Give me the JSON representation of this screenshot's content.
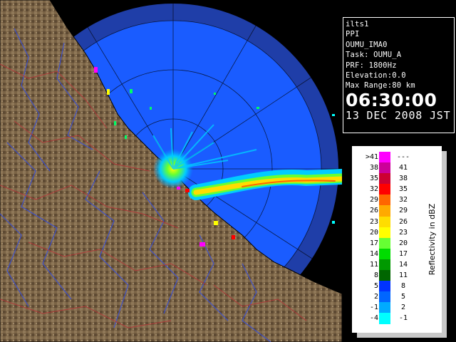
{
  "info_panel": {
    "lines": [
      "ilts1",
      "PPI",
      "OUMU_IMA0",
      "Task: OUMU_A",
      "PRF: 1800Hz",
      "Elevation:0.0",
      "Max Range:80 km"
    ],
    "time": "06:30:00",
    "date": "13 DEC 2008 JST"
  },
  "legend": {
    "title": "Reflectivity in dBZ",
    "rows": [
      {
        "lo": ">41",
        "hi": "---",
        "color": "#ff00ff"
      },
      {
        "lo": "38",
        "hi": "41",
        "color": "#cc0099"
      },
      {
        "lo": "35",
        "hi": "38",
        "color": "#cc0033"
      },
      {
        "lo": "32",
        "hi": "35",
        "color": "#ff0000"
      },
      {
        "lo": "29",
        "hi": "32",
        "color": "#ff6600"
      },
      {
        "lo": "26",
        "hi": "29",
        "color": "#ffaa00"
      },
      {
        "lo": "23",
        "hi": "26",
        "color": "#ffdd00"
      },
      {
        "lo": "20",
        "hi": "23",
        "color": "#ffff00"
      },
      {
        "lo": "17",
        "hi": "20",
        "color": "#66ff33"
      },
      {
        "lo": "14",
        "hi": "17",
        "color": "#00dd00"
      },
      {
        "lo": "11",
        "hi": "14",
        "color": "#009900"
      },
      {
        "lo": "8",
        "hi": "11",
        "color": "#006600"
      },
      {
        "lo": "5",
        "hi": "8",
        "color": "#0033ff"
      },
      {
        "lo": "2",
        "hi": "5",
        "color": "#0066ff"
      },
      {
        "lo": "-1",
        "hi": "2",
        "color": "#00aaff"
      },
      {
        "lo": "-4",
        "hi": "-1",
        "color": "#00ffff"
      }
    ]
  },
  "radar": {
    "sea_color": "#1a5cff",
    "outer_color": "#1f3ea8",
    "land_color": "#7a6347",
    "echo_band_colors": [
      "#0099ff",
      "#00ffff",
      "#66ff33",
      "#ffff00",
      "#ffaa00",
      "#ff0000"
    ]
  }
}
